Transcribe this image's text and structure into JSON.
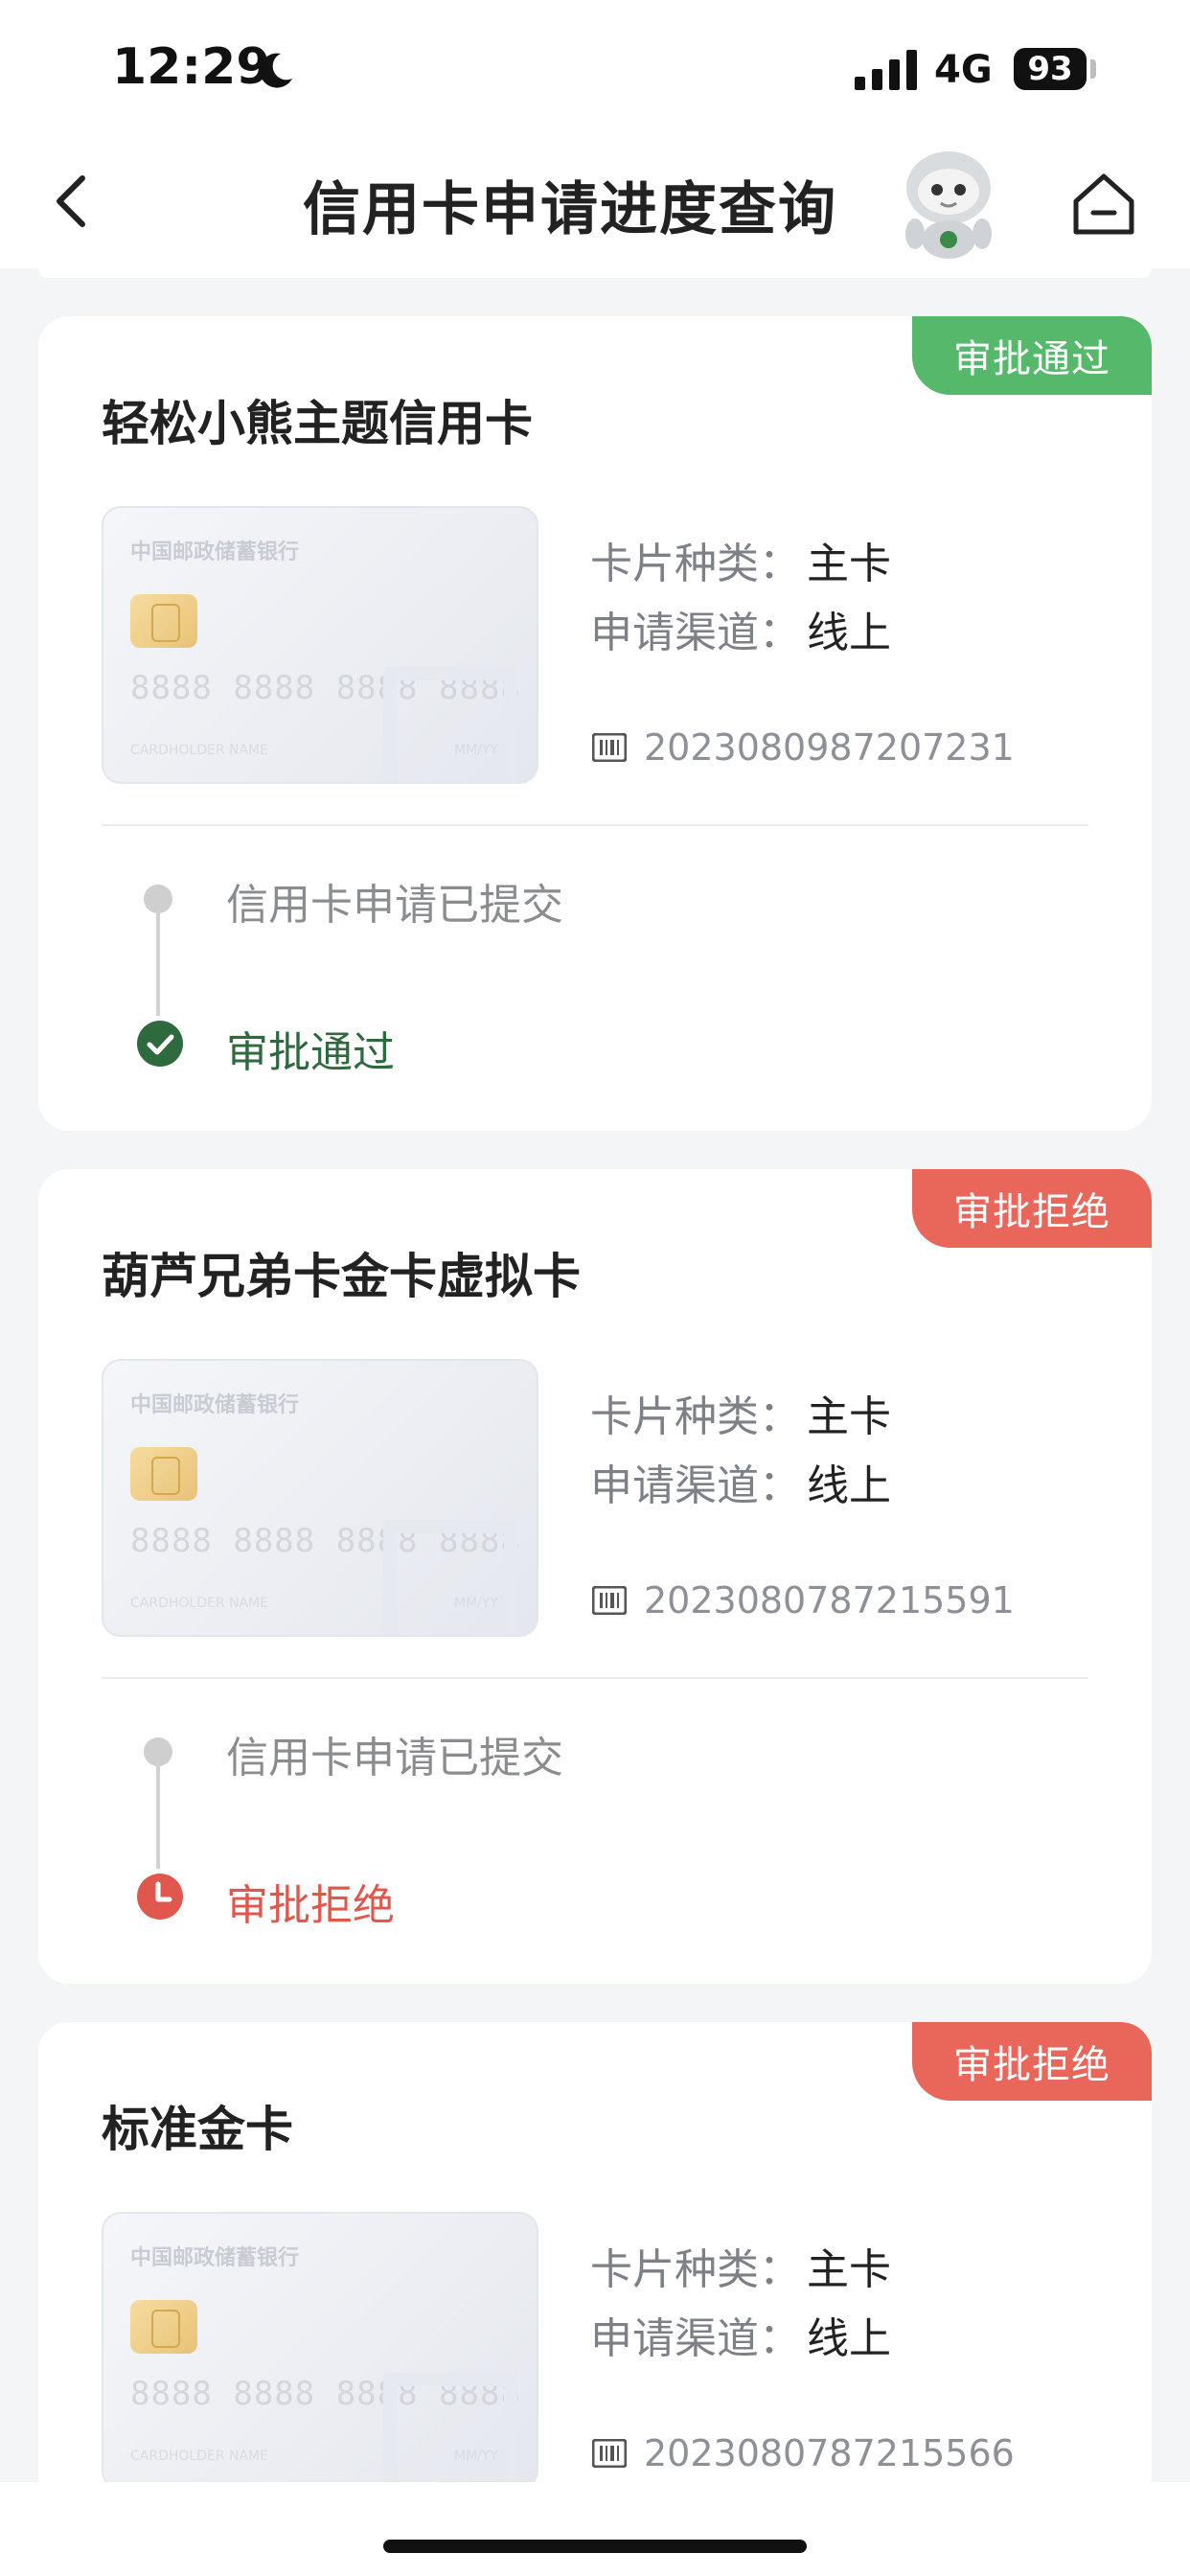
{
  "status_bar": {
    "time": "12:29",
    "network": "4G",
    "battery": "93"
  },
  "nav": {
    "title": "信用卡申请进度查询"
  },
  "labels": {
    "card_type": "卡片种类：",
    "channel": "申请渠道："
  },
  "card_art": {
    "bank_name": "中国邮政储蓄银行",
    "number": "8888 8888 8888 8888",
    "holder": "CARDHOLDER NAME",
    "expiry": "MM/YY"
  },
  "applications": [
    {
      "title": "轻松小熊主题信用卡",
      "badge": "审批通过",
      "card_type": "主卡",
      "channel": "线上",
      "order_no": "2023080987207231",
      "step1": "信用卡申请已提交",
      "result": "审批通过"
    },
    {
      "title": "葫芦兄弟卡金卡虚拟卡",
      "badge": "审批拒绝",
      "card_type": "主卡",
      "channel": "线上",
      "order_no": "2023080787215591",
      "step1": "信用卡申请已提交",
      "result": "审批拒绝"
    },
    {
      "title": "标准金卡",
      "badge": "审批拒绝",
      "card_type": "主卡",
      "channel": "线上",
      "order_no": "2023080787215566"
    }
  ],
  "colors": {
    "approved": "#55b86b",
    "rejected": "#e8665a",
    "approved_text": "#2e6a3e"
  }
}
